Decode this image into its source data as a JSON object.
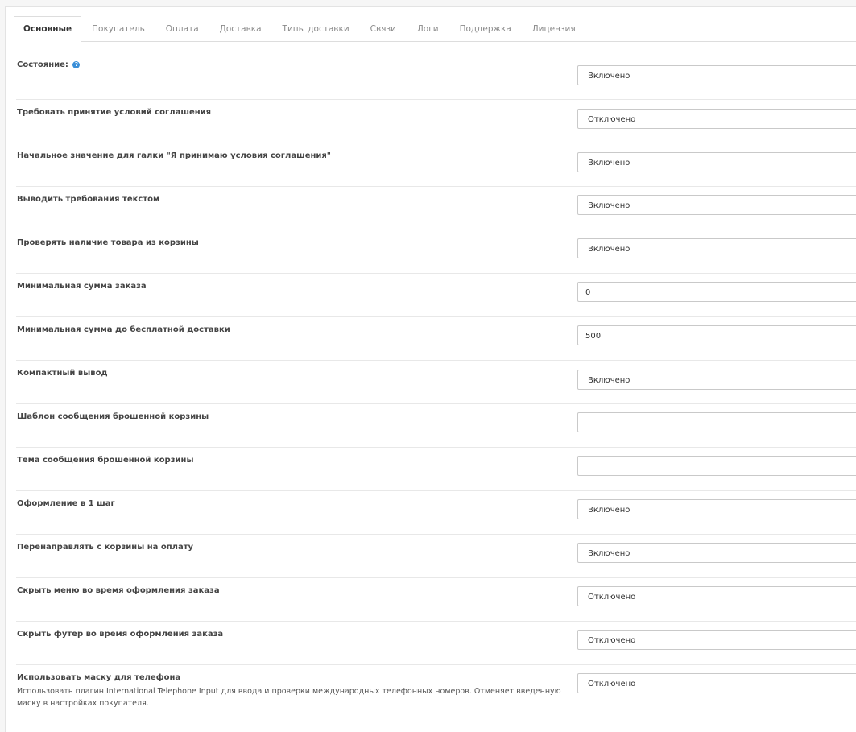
{
  "tabs": [
    {
      "label": "Основные",
      "active": true
    },
    {
      "label": "Покупатель"
    },
    {
      "label": "Оплата"
    },
    {
      "label": "Доставка"
    },
    {
      "label": "Типы доставки"
    },
    {
      "label": "Связи"
    },
    {
      "label": "Логи"
    },
    {
      "label": "Поддержка"
    },
    {
      "label": "Лицензия"
    }
  ],
  "help_icon": {
    "glyph": "?",
    "icon": "question-circle-icon",
    "color": "#3a8fd8"
  },
  "settings": [
    {
      "label": "Состояние:",
      "control": "select",
      "value": "Включено",
      "help": true
    },
    {
      "label": "Требовать принятие условий соглашения",
      "control": "select",
      "value": "Отключено"
    },
    {
      "label": "Начальное значение для галки \"Я принимаю условия соглашения\"",
      "control": "select",
      "value": "Включено"
    },
    {
      "label": "Выводить требования текстом",
      "control": "select",
      "value": "Включено"
    },
    {
      "label": "Проверять наличие товара из корзины",
      "control": "select",
      "value": "Включено"
    },
    {
      "label": "Минимальная сумма заказа",
      "control": "input",
      "value": "0"
    },
    {
      "label": "Минимальная сумма до бесплатной доставки",
      "control": "input",
      "value": "500"
    },
    {
      "label": "Компактный вывод",
      "control": "select",
      "value": "Включено"
    },
    {
      "label": "Шаблон сообщения брошенной корзины",
      "control": "input",
      "value": ""
    },
    {
      "label": "Тема сообщения брошенной корзины",
      "control": "input",
      "value": ""
    },
    {
      "label": "Оформление в 1 шаг",
      "control": "select",
      "value": "Включено"
    },
    {
      "label": "Перенаправлять с корзины на оплату",
      "control": "select",
      "value": "Включено"
    },
    {
      "label": "Скрыть меню во время оформления заказа",
      "control": "select",
      "value": "Отключено"
    },
    {
      "label": "Скрыть футер во время оформления заказа",
      "control": "select",
      "value": "Отключено"
    },
    {
      "label": "Использовать маску для телефона",
      "control": "select",
      "value": "Отключено",
      "description": "Использовать плагин International Telephone Input для ввода и проверки международных телефонных номеров. Отменяет введенную маску в настройках покупателя."
    }
  ]
}
